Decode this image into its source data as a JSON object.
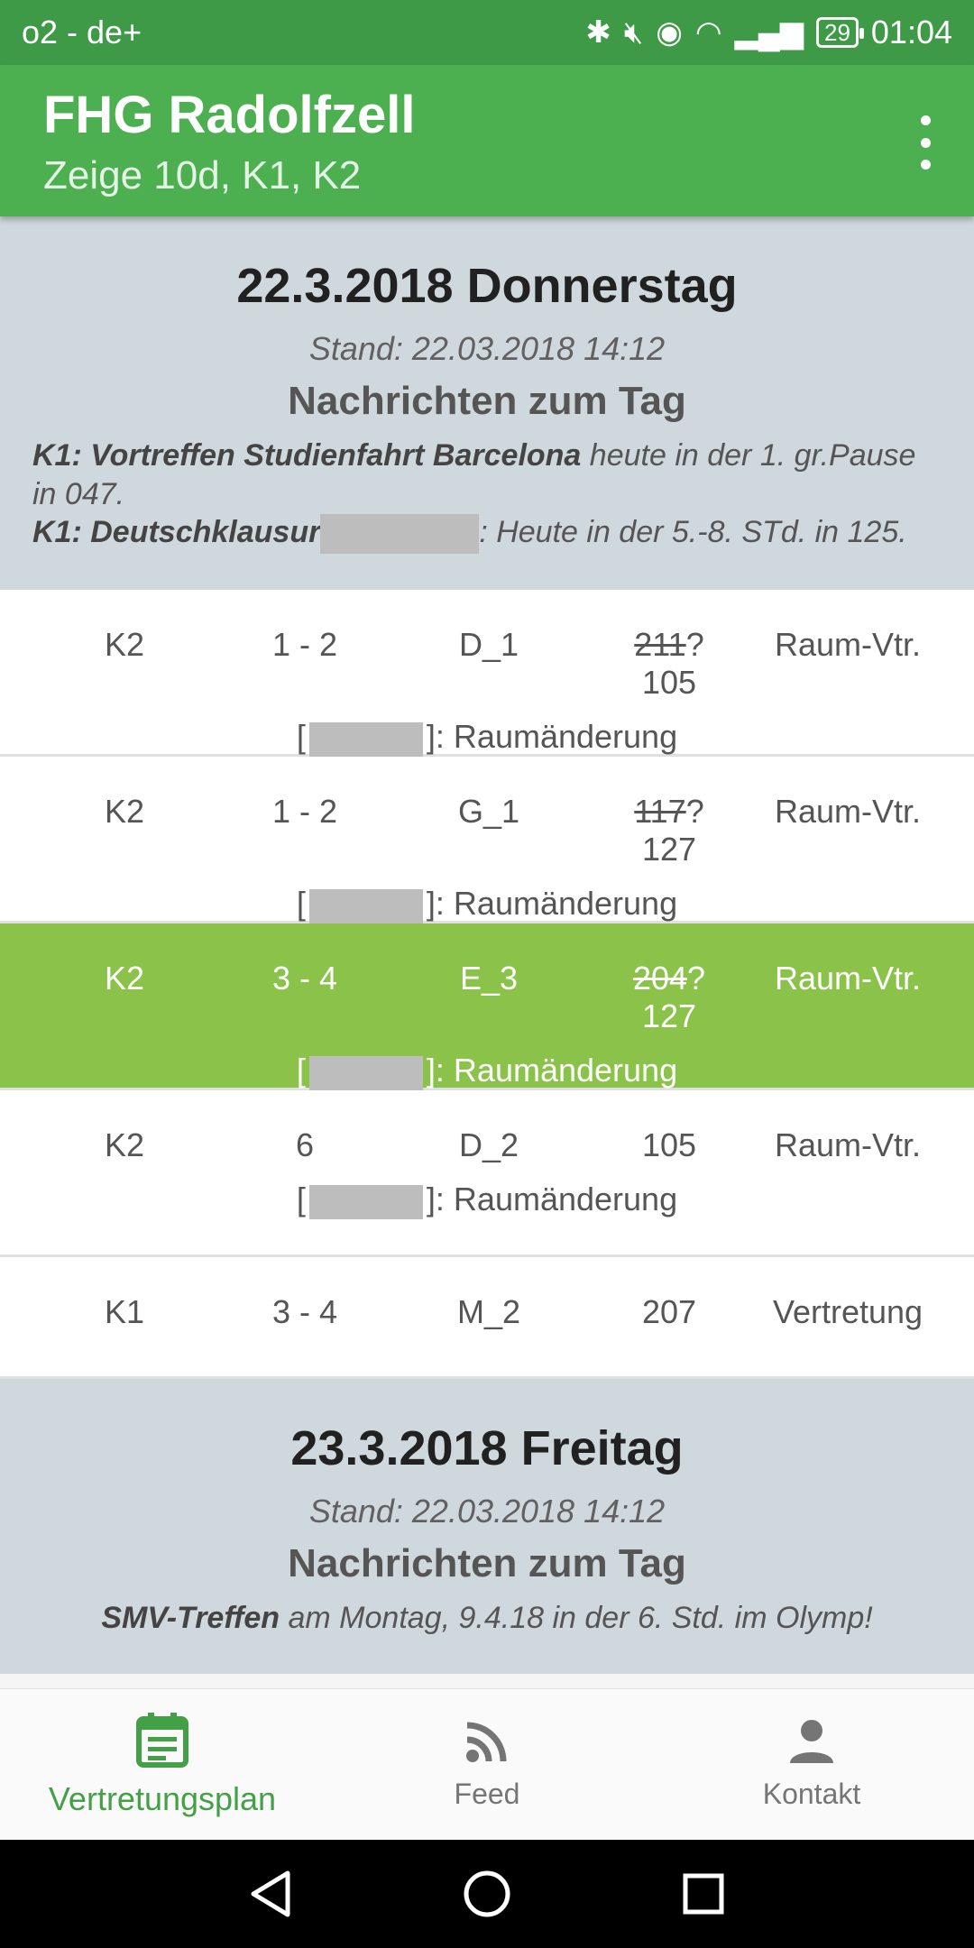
{
  "status_bar": {
    "carrier": "o2 - de+",
    "battery": "29",
    "time": "01:04"
  },
  "app_bar": {
    "title": "FHG Radolfzell",
    "subtitle": "Zeige 10d, K1, K2"
  },
  "days": [
    {
      "title": "22.3.2018 Donnerstag",
      "stand": "Stand: 22.03.2018 14:12",
      "news_title": "Nachrichten zum Tag",
      "news_1_bold": "K1: Vortreffen Studienfahrt Barcelona",
      "news_1_text": " heute in der 1. gr.Pause in 047.",
      "news_2_bold": "K1: Deutschklausur",
      "news_2_text": ": Heute in der 5.-8. STd. in 125.",
      "rows": [
        {
          "klasse": "K2",
          "stunde": "1 - 2",
          "fach": "D_1",
          "raum_alt": "211",
          "raum_neu": "?105",
          "art": "Raum-Vtr.",
          "note": ": Raumänderung"
        },
        {
          "klasse": "K2",
          "stunde": "1 - 2",
          "fach": "G_1",
          "raum_alt": "117",
          "raum_neu": "?127",
          "art": "Raum-Vtr.",
          "note": ": Raumänderung"
        },
        {
          "klasse": "K2",
          "stunde": "3 - 4",
          "fach": "E_3",
          "raum_alt": "204",
          "raum_neu": "?127",
          "art": "Raum-Vtr.",
          "note": ": Raumänderung"
        },
        {
          "klasse": "K2",
          "stunde": "6",
          "fach": "D_2",
          "raum_alt": "",
          "raum_neu": "105",
          "art": "Raum-Vtr.",
          "note": ": Raumänderung"
        },
        {
          "klasse": "K1",
          "stunde": "3 - 4",
          "fach": "M_2",
          "raum_alt": "",
          "raum_neu": "207",
          "art": "Vertretung",
          "note": ""
        }
      ]
    },
    {
      "title": "23.3.2018 Freitag",
      "stand": "Stand: 22.03.2018 14:12",
      "news_title": "Nachrichten zum Tag",
      "news_1_bold": "SMV-Treffen",
      "news_1_text": " am Montag, 9.4.18 in der 6. Std. im Olymp!"
    }
  ],
  "bottom_nav": {
    "item_1": "Vertretungsplan",
    "item_2": "Feed",
    "item_3": "Kontakt"
  },
  "colors": {
    "status_bar": "#3f9a48",
    "app_bar": "#4caf50",
    "highlight_row": "#8bc34a",
    "day_header": "#cfd8dc",
    "nav_active": "#43a047"
  }
}
